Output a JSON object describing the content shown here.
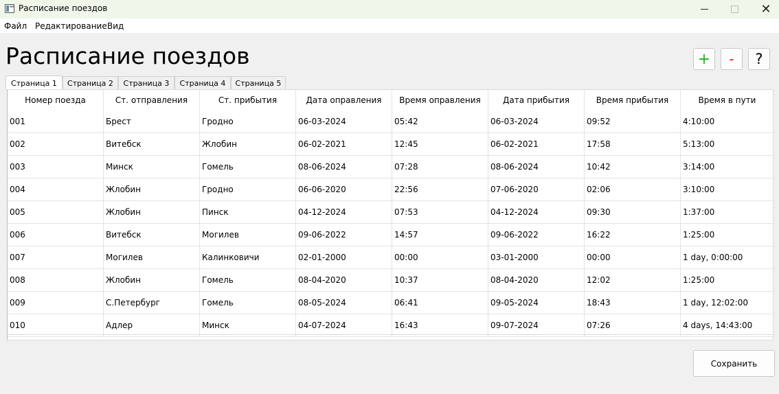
{
  "window": {
    "title": "Расписание поездов",
    "icon": "app-window-icon",
    "controls": {
      "minimize": "minimize-icon",
      "maximize": "maximize-icon",
      "close": "✕"
    }
  },
  "menu": [
    "Файл",
    "Редактирование",
    "Вид"
  ],
  "page_title": "Расписание поездов",
  "toolbar": {
    "add_label": "+",
    "remove_label": "-",
    "help_label": "?"
  },
  "tabs": [
    "Страница 1",
    "Страница 2",
    "Страница 3",
    "Страница 4",
    "Страница 5"
  ],
  "active_tab": 0,
  "table": {
    "columns": [
      "Номер поезда",
      "Ст. отправления",
      "Ст. прибытия",
      "Дата оправления",
      "Время оправления",
      "Дата прибытия",
      "Время прибытия",
      "Время в пути"
    ],
    "rows": [
      [
        "001",
        "Брест",
        "Гродно",
        "06-03-2024",
        "05:42",
        "06-03-2024",
        "09:52",
        "4:10:00"
      ],
      [
        "002",
        "Витебск",
        "Жлобин",
        "06-02-2021",
        "12:45",
        "06-02-2021",
        "17:58",
        "5:13:00"
      ],
      [
        "003",
        "Минск",
        "Гомель",
        "08-06-2024",
        "07:28",
        "08-06-2024",
        "10:42",
        "3:14:00"
      ],
      [
        "004",
        "Жлобин",
        "Гродно",
        "06-06-2020",
        "22:56",
        "07-06-2020",
        "02:06",
        "3:10:00"
      ],
      [
        "005",
        "Жлобин",
        "Пинск",
        "04-12-2024",
        "07:53",
        "04-12-2024",
        "09:30",
        "1:37:00"
      ],
      [
        "006",
        "Витебск",
        "Могилев",
        "09-06-2022",
        "14:57",
        "09-06-2022",
        "16:22",
        "1:25:00"
      ],
      [
        "007",
        "Могилев",
        "Калинковичи",
        "02-01-2000",
        "00:00",
        "03-01-2000",
        "00:00",
        "1 day, 0:00:00"
      ],
      [
        "008",
        "Жлобин",
        "Гомель",
        "08-04-2020",
        "10:37",
        "08-04-2020",
        "12:02",
        "1:25:00"
      ],
      [
        "009",
        "С.Петербург",
        "Гомель",
        "08-05-2024",
        "06:41",
        "09-05-2024",
        "18:43",
        "1 day, 12:02:00"
      ],
      [
        "010",
        "Адлер",
        "Минск",
        "04-07-2024",
        "16:43",
        "09-07-2024",
        "07:26",
        "4 days, 14:43:00"
      ]
    ]
  },
  "save_label": "Сохранить",
  "colors": {
    "add": "#1ab51a",
    "remove": "#ee1111",
    "titlebar": "#eef7ea"
  }
}
